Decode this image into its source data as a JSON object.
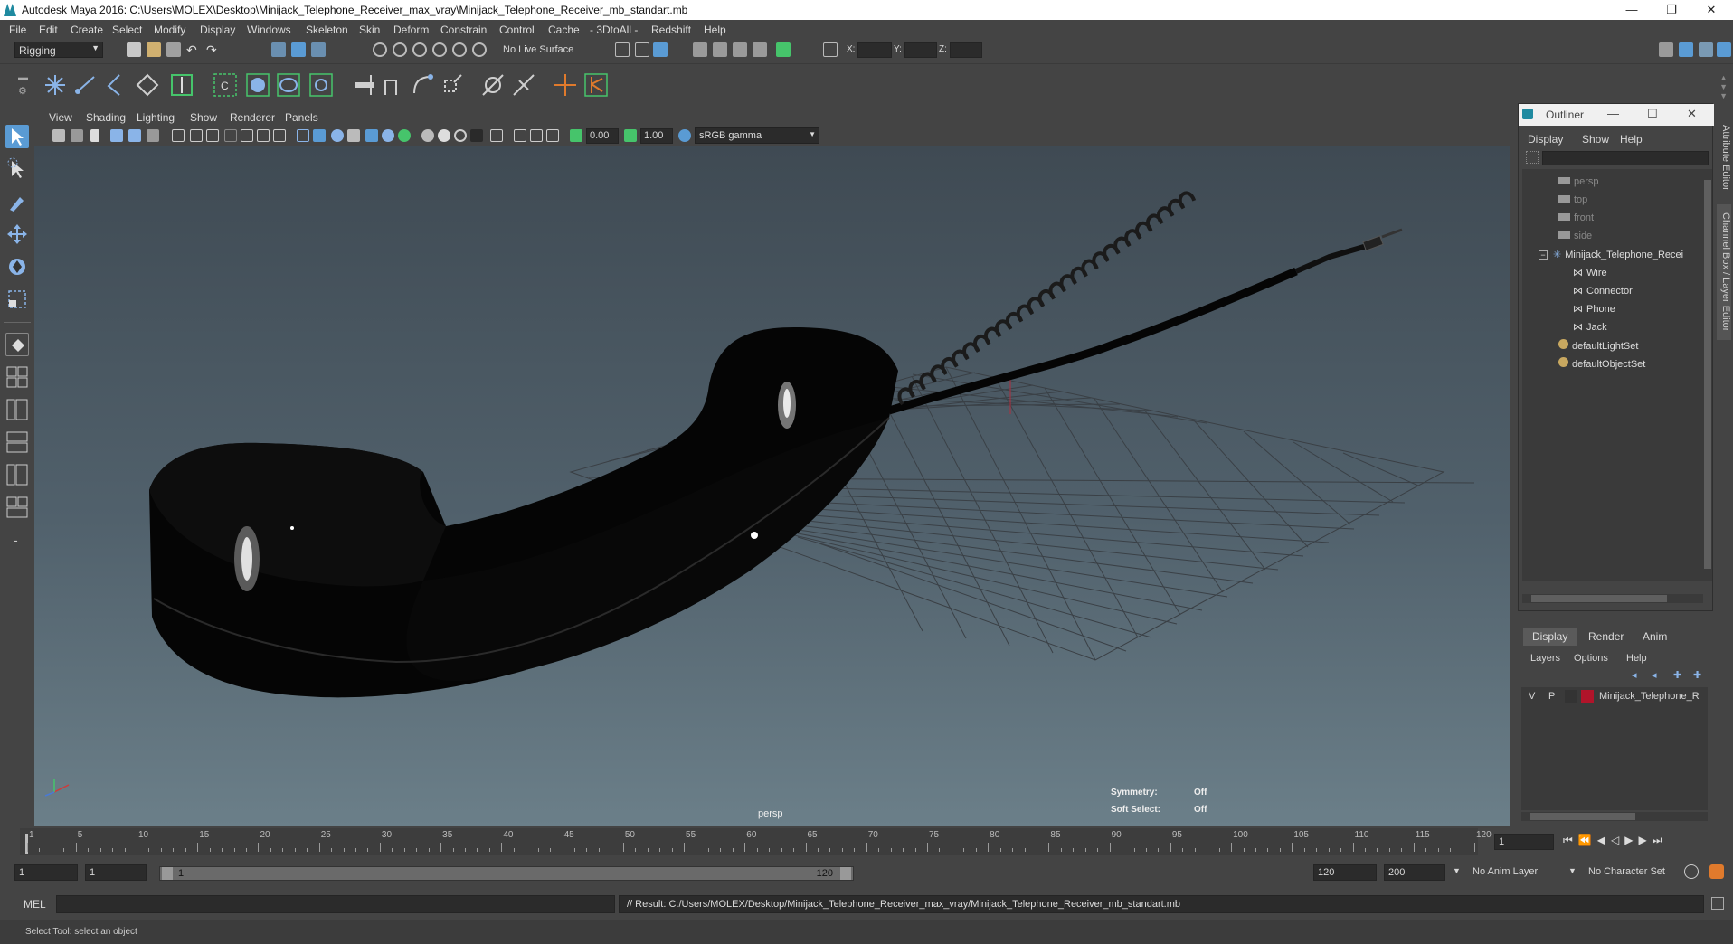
{
  "window": {
    "title": "Autodesk Maya 2016: C:\\Users\\MOLEX\\Desktop\\Minijack_Telephone_Receiver_max_vray\\Minijack_Telephone_Receiver_mb_standart.mb",
    "minimize": "—",
    "restore": "❐",
    "close": "✕"
  },
  "menubar": [
    "File",
    "Edit",
    "Create",
    "Select",
    "Modify",
    "Display",
    "Windows",
    "Skeleton",
    "Skin",
    "Deform",
    "Constrain",
    "Control",
    "Cache",
    "- 3DtoAll -",
    "Redshift",
    "Help"
  ],
  "statusline": {
    "menuset": "Rigging",
    "live_surface": "No Live Surface",
    "x_label": "X:",
    "y_label": "Y:",
    "z_label": "Z:"
  },
  "viewport": {
    "menus": [
      "View",
      "Shading",
      "Lighting",
      "Show",
      "Renderer",
      "Panels"
    ],
    "exposure": "0.00",
    "gamma": "1.00",
    "color_space": "sRGB gamma",
    "camera_label": "persp",
    "hud": {
      "symmetry_label": "Symmetry:",
      "symmetry_value": "Off",
      "soft_select_label": "Soft Select:",
      "soft_select_value": "Off"
    }
  },
  "outliner": {
    "title": "Outliner",
    "menus": [
      "Display",
      "Show",
      "Help"
    ],
    "cameras": [
      "persp",
      "top",
      "front",
      "side"
    ],
    "group": "Minijack_Telephone_Recei",
    "children": [
      "Wire",
      "Connector",
      "Phone",
      "Jack"
    ],
    "sets": [
      "defaultLightSet",
      "defaultObjectSet"
    ]
  },
  "side_tabs": {
    "attribute_editor": "Attribute Editor",
    "channel_box": "Channel Box / Layer Editor"
  },
  "layer_editor": {
    "tabs": [
      "Display",
      "Render",
      "Anim"
    ],
    "menus": [
      "Layers",
      "Options",
      "Help"
    ],
    "layer": {
      "v": "V",
      "p": "P",
      "name": "Minijack_Telephone_R",
      "color": "#b0142a"
    }
  },
  "timeslider": {
    "labels": [
      "1",
      "5",
      "10",
      "15",
      "20",
      "25",
      "30",
      "35",
      "40",
      "45",
      "50",
      "55",
      "60",
      "65",
      "70",
      "75",
      "80",
      "85",
      "90",
      "95",
      "100",
      "105",
      "110",
      "115",
      "120"
    ],
    "current_frame": "1"
  },
  "range": {
    "start": "1",
    "playback_start": "1",
    "slider_start": "1",
    "slider_end": "120",
    "playback_end": "120",
    "end": "200",
    "anim_layer": "No Anim Layer",
    "character_set": "No Character Set"
  },
  "commandline": {
    "lang": "MEL",
    "result": "// Result: C:/Users/MOLEX/Desktop/Minijack_Telephone_Receiver_max_vray/Minijack_Telephone_Receiver_mb_standart.mb"
  },
  "helpline": {
    "text": "Select Tool: select an object"
  },
  "colors": {
    "accent": "#5a9bd4",
    "ui_bg": "#444444",
    "shelf_green": "#46c46b",
    "shelf_orange": "#e07a2c"
  }
}
